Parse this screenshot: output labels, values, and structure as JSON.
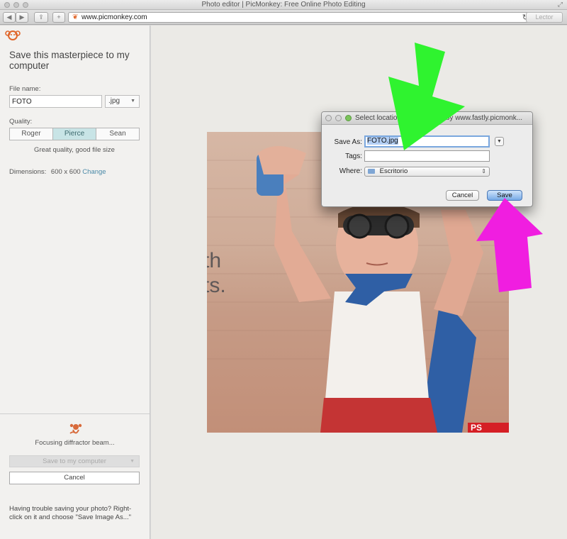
{
  "window": {
    "title": "Photo editor | PicMonkey: Free Online Photo Editing"
  },
  "toolbar": {
    "back_icon": "back-arrow-icon",
    "forward_icon": "forward-arrow-icon",
    "url": "www.picmonkey.com",
    "reader_label": "Lector"
  },
  "sidebar": {
    "heading": "Save this masterpiece to my computer",
    "file_name_label": "File name:",
    "file_name_value": "FOTO",
    "format_value": ".jpg",
    "quality_label": "Quality:",
    "quality_options": [
      "Roger",
      "Pierce",
      "Sean"
    ],
    "quality_selected": "Pierce",
    "quality_note": "Great quality, good file size",
    "dimensions_label": "Dimensions:",
    "dimensions_value": "600 x 600",
    "change_link": "Change",
    "status_text": "Focusing diffractor beam...",
    "save_button": "Save to my computer",
    "cancel_button": "Cancel",
    "trouble_text": "Having trouble saving your photo? Right-click on it and choose \"Save Image As...\""
  },
  "photo": {
    "text_line1": "th",
    "text_line2": "ts.",
    "badge_text": "PS"
  },
  "dialog": {
    "title": "Select location for download by www.fastly.picmonk...",
    "save_as_label": "Save As:",
    "save_as_value": "FOTO.jpg",
    "tags_label": "Tags:",
    "tags_value": "",
    "where_label": "Where:",
    "where_value": "Escritorio",
    "cancel_button": "Cancel",
    "save_button": "Save"
  },
  "colors": {
    "accent_orange": "#e0662a",
    "link_blue": "#4b8aa8",
    "selected_segment": "#c8e4e6",
    "arrow_green": "#2ff32f",
    "arrow_magenta": "#f01ee0"
  }
}
